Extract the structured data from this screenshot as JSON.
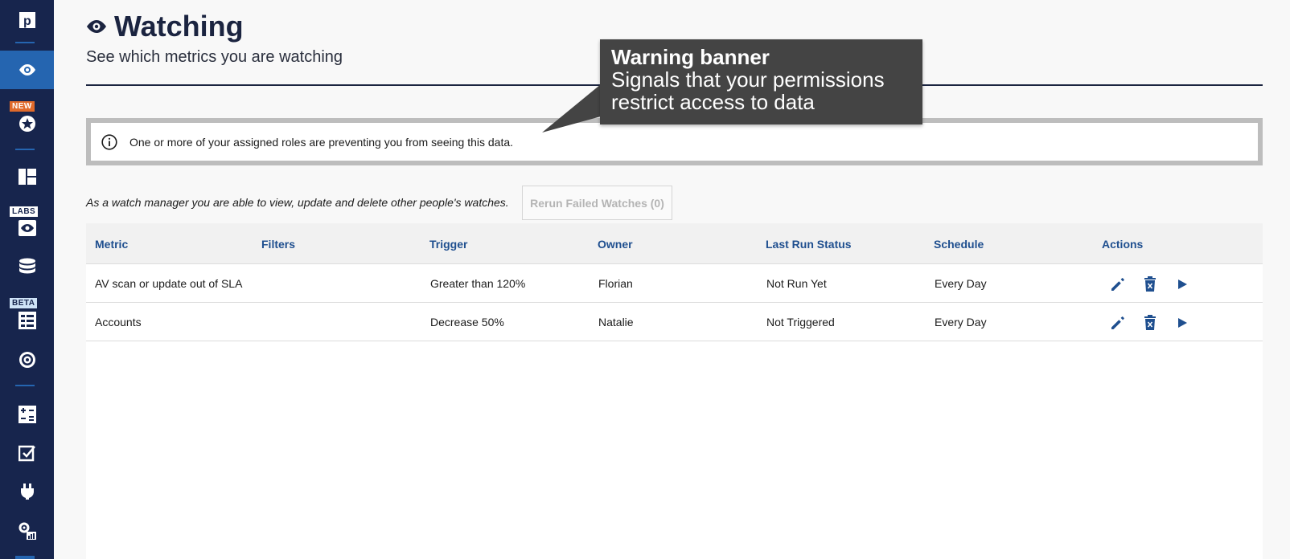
{
  "sidebar": {
    "badges": {
      "new": "NEW",
      "labs": "LABS",
      "beta": "BETA"
    },
    "items": [
      {
        "icon": "logo-icon"
      },
      {
        "icon": "eye-icon",
        "active": true
      },
      {
        "icon": "star-icon"
      },
      {
        "icon": "dashboard-icon"
      },
      {
        "icon": "labs-eye-icon"
      },
      {
        "icon": "database-icon"
      },
      {
        "icon": "checklist-icon"
      },
      {
        "icon": "target-icon"
      },
      {
        "icon": "calculator-icon"
      },
      {
        "icon": "task-icon"
      },
      {
        "icon": "plug-icon"
      },
      {
        "icon": "settings-chart-icon"
      }
    ]
  },
  "header": {
    "title": "Watching",
    "subtitle": "See which metrics you are watching"
  },
  "banner": {
    "text": "One or more of your assigned roles are preventing you from seeing this data."
  },
  "callout": {
    "title": "Warning banner",
    "body_line1": "Signals that your permissions",
    "body_line2": "restrict access to data"
  },
  "manager_note": "As a watch manager you are able to view, update and delete other people's watches.",
  "rerun_button": "Rerun Failed Watches (0)",
  "table": {
    "columns": [
      "Metric",
      "Filters",
      "Trigger",
      "Owner",
      "Last Run Status",
      "Schedule",
      "Actions"
    ],
    "rows": [
      {
        "metric": "AV scan or update out of SLA",
        "filters": "",
        "trigger": "Greater than 120%",
        "owner": "Florian",
        "status": "Not Run Yet",
        "schedule": "Every Day"
      },
      {
        "metric": "Accounts",
        "filters": "",
        "trigger": "Decrease 50%",
        "owner": "Natalie",
        "status": "Not Triggered",
        "schedule": "Every Day"
      }
    ]
  },
  "colors": {
    "sidebar": "#17254d",
    "sidebar_active": "#2565b0",
    "accent": "#1f4f8f",
    "badge_new": "#e06a2b"
  }
}
